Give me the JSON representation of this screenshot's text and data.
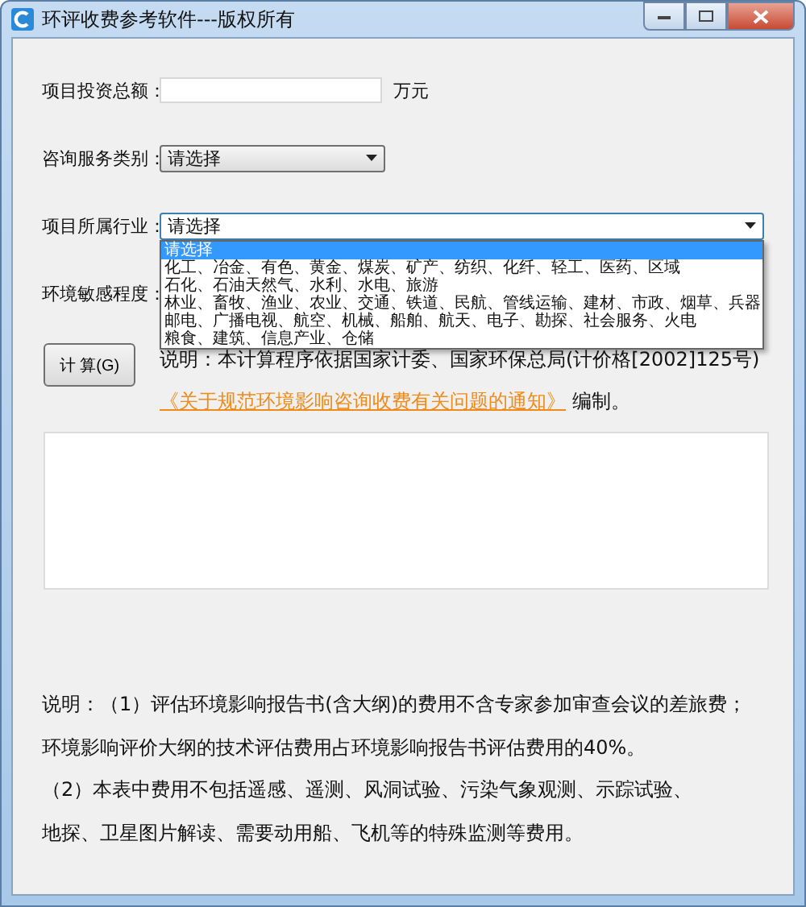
{
  "window": {
    "title": "环评收费参考软件---版权所有"
  },
  "fields": [
    {
      "kind": "input",
      "label": "项目投资总额：",
      "unit": "万元"
    },
    {
      "kind": "select",
      "label": "咨询服务类别：",
      "value": "请选择",
      "expanded": false
    },
    {
      "kind": "select",
      "label": "项目所属行业：",
      "value": "请选择",
      "expanded": true,
      "options": [
        {
          "label": "请选择",
          "selected": true
        },
        {
          "label": "化工、冶金、有色、黄金、煤炭、矿产、纺织、化纤、轻工、医药、区域",
          "selected": false
        },
        {
          "label": "石化、石油天然气、水利、水电、旅游",
          "selected": false
        },
        {
          "label": "林业、畜牧、渔业、农业、交通、铁道、民航、管线运输、建材、市政、烟草、兵器",
          "selected": false
        },
        {
          "label": "邮电、广播电视、航空、机械、船舶、航天、电子、勘探、社会服务、火电",
          "selected": false
        },
        {
          "label": "粮食、建筑、信息产业、仓储",
          "selected": false
        }
      ]
    },
    {
      "kind": "label",
      "label": "环境敏感程度："
    }
  ],
  "calculate_button": "计 算(G)",
  "note": {
    "text": "说明：本计算程序依据国家计委、国家环保总局(计价格[2002]125号)",
    "link": "《关于规范环境影响咨询收费有关问题的通知》",
    "after": " 编制。"
  },
  "remarks": [
    "说明：（1）评估环境影响报告书(含大纲)的费用不含专家参加审查会议的差旅费；",
    "环境影响评价大纲的技术评估费用占环境影响报告书评估费用的40%。",
    "（2）本表中费用不包括遥感、遥测、风洞试验、污染气象观测、示踪试验、",
    "地探、卫星图片解读、需要动用船、飞机等的特殊监测等费用。"
  ]
}
